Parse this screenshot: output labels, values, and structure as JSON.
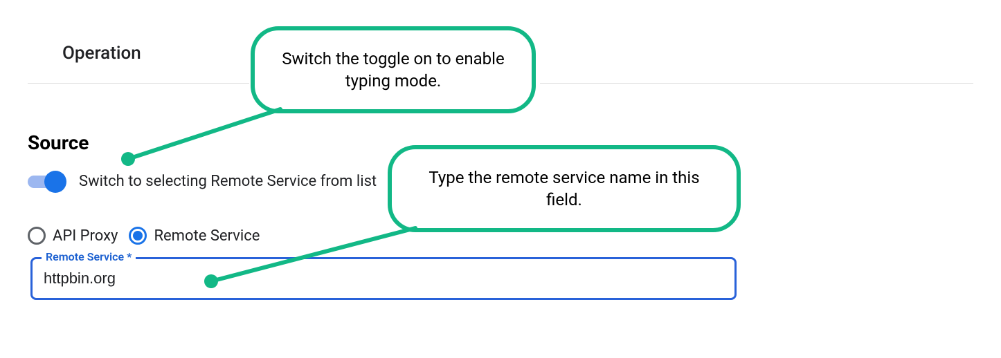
{
  "colors": {
    "accent_teal": "#12b886",
    "accent_blue": "#1a73e8",
    "field_border": "#2962d9"
  },
  "operation": {
    "title": "Operation"
  },
  "source": {
    "title": "Source",
    "toggle_label": "Switch to selecting Remote Service from list",
    "toggle_on": true,
    "radios": {
      "api_proxy_label": "API Proxy",
      "remote_service_label": "Remote Service",
      "selected": "remote_service"
    },
    "field": {
      "label": "Remote Service *",
      "value": "httpbin.org"
    }
  },
  "callouts": {
    "toggle_hint": "Switch the toggle on to enable typing mode.",
    "field_hint": "Type the remote service name in this field."
  }
}
